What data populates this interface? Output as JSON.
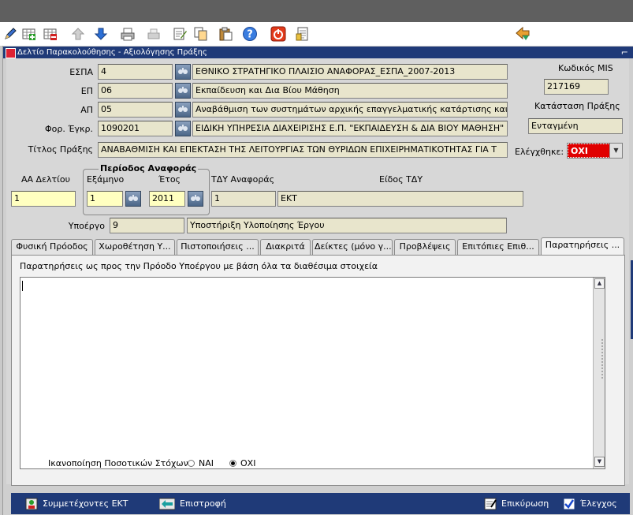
{
  "window": {
    "title": "Δελτίο Παρακολούθησης - Αξιολόγησης Πράξης",
    "maximize_glyph": "⌐"
  },
  "toolbar": {
    "icons": [
      "pencil-icon",
      "add-record-icon",
      "delete-record-icon",
      "up-arrow-icon",
      "down-arrow-icon",
      "print-icon",
      "print-preview-icon",
      "edit-icon",
      "copy-icon",
      "paste-icon",
      "help-icon",
      "exit-icon",
      "document-icon",
      "navigate-icon"
    ]
  },
  "labels": {
    "espa": "ΕΣΠΑ",
    "ep": "ΕΠ",
    "ap": "ΑΠ",
    "for_egkr": "Φορ. Έγκρ.",
    "titlos": "Τίτλος Πράξης",
    "kodikos_mis": "Κωδικός MIS",
    "katastasi": "Κατάσταση Πράξης",
    "elegxthike": "Ελέγχθηκε:",
    "aa_deltiou": "ΑΑ Δελτίου",
    "periodos": "Περίοδος Αναφοράς",
    "examino": "Εξάμηνο",
    "etos": "Έτος",
    "tdy": "ΤΔΥ Αναφοράς",
    "eidos_tdy": "Είδος ΤΔΥ",
    "ypoergo": "Υποέργο"
  },
  "fields": {
    "espa_code": "4",
    "espa_desc": "ΕΘΝΙΚΟ ΣΤΡΑΤΗΓΙΚΟ ΠΛΑΙΣΙΟ ΑΝΑΦΟΡΑΣ_ΕΣΠΑ_2007-2013",
    "ep_code": "06",
    "ep_desc": "Εκπαίδευση και Δια Βίου Μάθηση",
    "ap_code": "05",
    "ap_desc": "Αναβάθμιση των συστημάτων αρχικής επαγγελματικής κατάρτισης και επα",
    "for_code": "1090201",
    "for_desc": "ΕΙΔΙΚΗ ΥΠΗΡΕΣΙΑ ΔΙΑΧΕΙΡΙΣΗΣ Ε.Π. \"ΕΚΠΑΙΔΕΥΣΗ & ΔΙΑ ΒΙΟΥ ΜΑΘΗΣΗ\"",
    "titlos": "ΑΝΑΒΑΘΜΙΣΗ ΚΑΙ ΕΠΕΚΤΑΣΗ ΤΗΣ ΛΕΙΤΟΥΡΓΙΑΣ ΤΩΝ ΘΥΡΙΔΩΝ ΕΠΙΧΕΙΡΗΜΑΤΙΚΟΤΗΤΑΣ ΓΙΑ Τ",
    "mis": "217169",
    "katastasi": "Ενταγμένη",
    "elegxthike": "ΟΧΙ",
    "aa_deltiou": "1",
    "examino": "1",
    "etos": "2011",
    "tdy_code": "1",
    "tdy_desc": "ΕΚΤ",
    "ypoergo_code": "9",
    "ypoergo_desc": "Υποστήριξη Υλοποίησης Έργου"
  },
  "tabs": [
    {
      "label": "Φυσική Πρόοδος"
    },
    {
      "label": "Χωροθέτηση Υ..."
    },
    {
      "label": "Πιστοποιήσεις ..."
    },
    {
      "label": "Διακριτά"
    },
    {
      "label": "Δείκτες (μόνο γ..."
    },
    {
      "label": "Προβλέψεις"
    },
    {
      "label": "Επιτόπιες Επιθ..."
    },
    {
      "label": "Παρατηρήσεις ..."
    }
  ],
  "panel": {
    "caption": "Παρατηρήσεις ως προς την Πρόοδο Υποέργου με βάση όλα τα διαθέσιμα στοιχεία",
    "textarea_value": "",
    "satisfaction_label": "Ικανοποίηση Ποσοτικών Στόχων",
    "opt_yes": "ΝΑΙ",
    "opt_no": "ΟΧΙ"
  },
  "bottom": {
    "participants": "Συμμετέχοντες ΕΚΤ",
    "back": "Επιστροφή",
    "validate": "Επικύρωση",
    "check": "Έλεγχος"
  }
}
